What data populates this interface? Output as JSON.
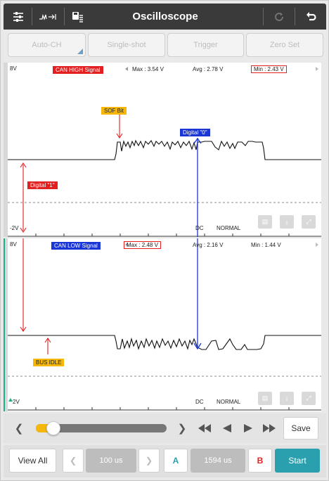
{
  "app": {
    "title": "Oscilloscope",
    "icons": [
      "settings-sliders-icon",
      "signal-arrows-icon",
      "save-data-icon",
      "refresh-icon",
      "back-icon"
    ]
  },
  "modes": {
    "auto_ch": "Auto-CH",
    "single_shot": "Single-shot",
    "trigger": "Trigger",
    "zero_set": "Zero Set"
  },
  "channel_high": {
    "top_label": "8V",
    "bottom_label": "-2V",
    "signal_name": "CAN HIGH Signal",
    "max": "Max : 3.54 V",
    "avg": "Avg : 2.78 V",
    "min": "Min : 2.43 V",
    "coupling": "DC",
    "mode": "NORMAL",
    "annotations": {
      "sof": "SOF Bit",
      "digital_zero": "Digital \"0\"",
      "digital_one": "Digital \"1\""
    }
  },
  "channel_low": {
    "top_label": "8V",
    "bottom_label": "2V",
    "signal_name": "CAN LOW Signal",
    "max": "Max : 2.48 V",
    "avg": "Avg : 2.16 V",
    "min": "Min : 1.44 V",
    "coupling": "DC",
    "mode": "NORMAL",
    "annotations": {
      "bus_idle": "BUS IDLE"
    }
  },
  "playback": {
    "slider_position": 0.08,
    "save": "Save"
  },
  "footer": {
    "view_all": "View All",
    "timebase": "100 us",
    "cursor_a": "A",
    "cursor_delta": "1594 us",
    "cursor_b": "B",
    "start": "Start"
  },
  "colors": {
    "accent_red": "#e32020",
    "accent_blue": "#1a37d6",
    "accent_yellow": "#f5b80a",
    "accent_teal": "#2a9fae",
    "top_bar": "#3a3a3a"
  }
}
